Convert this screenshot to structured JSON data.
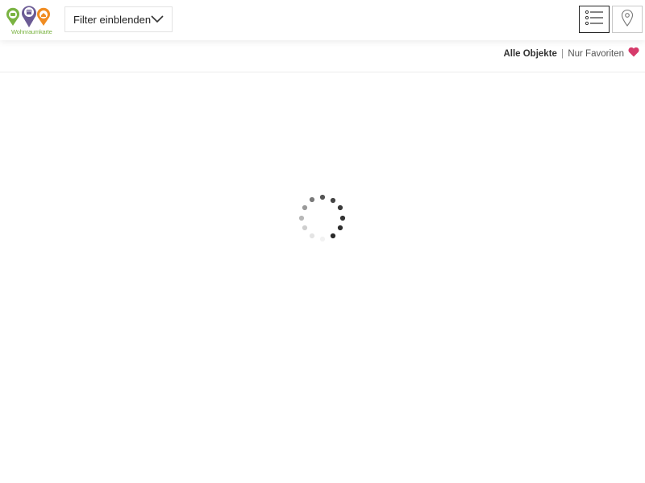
{
  "header": {
    "logo_text": "Wohnraumkarte",
    "filter_button_label": "Filter einblenden",
    "view_list_icon": "list-icon",
    "view_map_icon": "map-pin-icon"
  },
  "filterbar": {
    "option_all": "Alle Objekte",
    "separator": "|",
    "option_favorites": "Nur Favoriten",
    "heart_icon": "heart-icon"
  },
  "loading": {
    "spinner_icon": "loading-spinner-icon"
  },
  "colors": {
    "heart": "#d63b6b",
    "logo_green": "#7ab342",
    "logo_purple": "#6b5b95",
    "logo_orange": "#f08c21"
  }
}
